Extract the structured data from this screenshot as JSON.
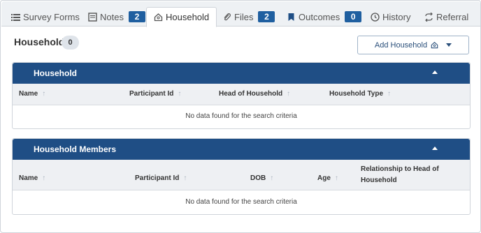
{
  "tabs": [
    {
      "label": "Survey Forms",
      "icon": "list-icon"
    },
    {
      "label": "Notes",
      "icon": "note-icon",
      "badge": "2"
    },
    {
      "label": "Household",
      "icon": "home-icon",
      "active": true
    },
    {
      "label": "Files",
      "icon": "paperclip-icon",
      "badge": "2"
    },
    {
      "label": "Outcomes",
      "icon": "bookmark-icon",
      "badge": "0"
    },
    {
      "label": "History",
      "icon": "clock-icon"
    },
    {
      "label": "Referral",
      "icon": "refresh-icon"
    }
  ],
  "header": {
    "title": "Household",
    "count": "0",
    "add_button_label": "Add Household"
  },
  "household_panel": {
    "title": "Household",
    "columns": [
      "Name",
      "Participant Id",
      "Head of Household",
      "Household Type"
    ],
    "empty_message": "No data found for the search criteria"
  },
  "members_panel": {
    "title": "Household Members",
    "columns": [
      "Name",
      "Participant Id",
      "DOB",
      "Age",
      "Relationship to Head of Household"
    ],
    "empty_message": "No data found for the search criteria"
  },
  "colors": {
    "panel_header": "#1f4e85",
    "badge": "#1f5fa0"
  }
}
